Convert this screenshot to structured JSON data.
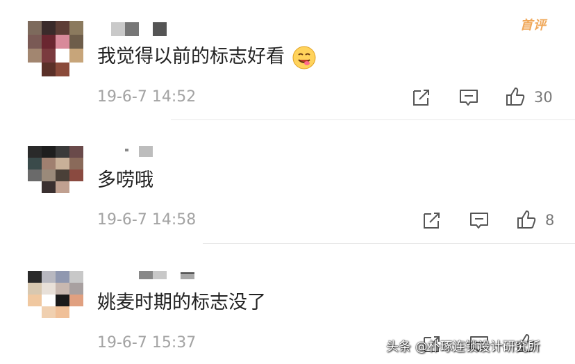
{
  "top_badge": "首评",
  "comments": [
    {
      "text": "我觉得以前的标志好看",
      "emoji": "yum-face-emoji",
      "time": "19-6-7 14:52",
      "likes": "30"
    },
    {
      "text": "多唠哦",
      "time": "19-6-7 14:58",
      "likes": "8"
    },
    {
      "text": "姚麦时期的标志没了",
      "time": "19-6-7 15:37",
      "likes": ""
    }
  ],
  "icons": {
    "share": "share-icon",
    "reply": "comment-icon",
    "like": "thumbs-up-icon"
  },
  "watermark": "头条 @朴琢连锁设计研究所",
  "colors": {
    "text": "#222222",
    "meta": "#a3a3a3",
    "badge": "#f0a85a",
    "divider": "#e8e8e8"
  }
}
